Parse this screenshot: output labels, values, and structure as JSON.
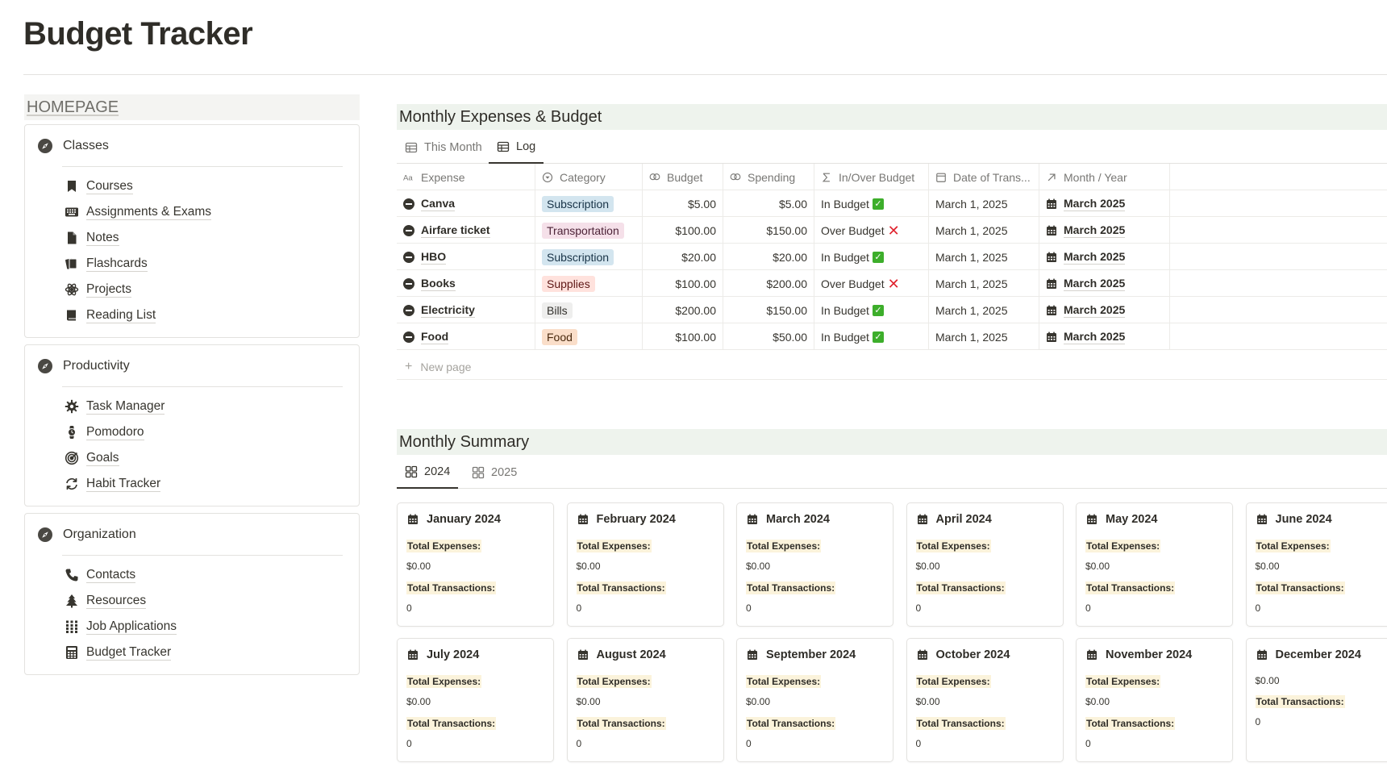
{
  "page": {
    "title": "Budget Tracker"
  },
  "sidebar": {
    "homepage_label": "HOMEPAGE",
    "groups": [
      {
        "title": "Classes",
        "icon": "compass-icon",
        "items": [
          {
            "label": "Courses",
            "icon": "bookmark-icon"
          },
          {
            "label": "Assignments & Exams",
            "icon": "keyboard-icon"
          },
          {
            "label": "Notes",
            "icon": "document-icon"
          },
          {
            "label": "Flashcards",
            "icon": "cards-icon"
          },
          {
            "label": "Projects",
            "icon": "atom-icon"
          },
          {
            "label": "Reading List",
            "icon": "book-icon"
          }
        ]
      },
      {
        "title": "Productivity",
        "icon": "compass-icon",
        "items": [
          {
            "label": "Task Manager",
            "icon": "gear-icon"
          },
          {
            "label": "Pomodoro",
            "icon": "watch-icon"
          },
          {
            "label": "Goals",
            "icon": "target-icon"
          },
          {
            "label": "Habit Tracker",
            "icon": "repeat-icon"
          }
        ]
      },
      {
        "title": "Organization",
        "icon": "compass-icon",
        "items": [
          {
            "label": "Contacts",
            "icon": "phone-icon"
          },
          {
            "label": "Resources",
            "icon": "tree-icon"
          },
          {
            "label": "Job Applications",
            "icon": "grid-icon"
          },
          {
            "label": "Budget Tracker",
            "icon": "calculator-icon"
          }
        ]
      }
    ]
  },
  "expenses": {
    "title": "Monthly Expenses & Budget",
    "tabs": [
      {
        "label": "This Month",
        "icon": "table-icon"
      },
      {
        "label": "Log",
        "icon": "table-icon"
      }
    ],
    "active_tab": "Log",
    "columns": [
      {
        "label": "Expense",
        "icon": "text-type-icon"
      },
      {
        "label": "Category",
        "icon": "select-icon"
      },
      {
        "label": "Budget",
        "icon": "formula-icon"
      },
      {
        "label": "Spending",
        "icon": "formula-icon"
      },
      {
        "label": "In/Over Budget",
        "icon": "sigma-icon"
      },
      {
        "label": "Date of Trans...",
        "icon": "calendar-icon"
      },
      {
        "label": "Month / Year",
        "icon": "relation-arrow-icon"
      }
    ],
    "rows": [
      {
        "expense": "Canva",
        "category": "Subscription",
        "budget": "$5.00",
        "spending": "$5.00",
        "status": "In Budget",
        "over": false,
        "date": "March 1, 2025",
        "month": "March 2025"
      },
      {
        "expense": "Airfare ticket",
        "category": "Transportation",
        "budget": "$100.00",
        "spending": "$150.00",
        "status": "Over Budget",
        "over": true,
        "date": "March 1, 2025",
        "month": "March 2025"
      },
      {
        "expense": "HBO",
        "category": "Subscription",
        "budget": "$20.00",
        "spending": "$20.00",
        "status": "In Budget",
        "over": false,
        "date": "March 1, 2025",
        "month": "March 2025"
      },
      {
        "expense": "Books",
        "category": "Supplies",
        "budget": "$100.00",
        "spending": "$200.00",
        "status": "Over Budget",
        "over": true,
        "date": "March 1, 2025",
        "month": "March 2025"
      },
      {
        "expense": "Electricity",
        "category": "Bills",
        "budget": "$200.00",
        "spending": "$150.00",
        "status": "In Budget",
        "over": false,
        "date": "March 1, 2025",
        "month": "March 2025"
      },
      {
        "expense": "Food",
        "category": "Food",
        "budget": "$100.00",
        "spending": "$50.00",
        "status": "In Budget",
        "over": false,
        "date": "March 1, 2025",
        "month": "March 2025"
      }
    ],
    "category_colors": {
      "Subscription": {
        "bg": "#d3e5ef",
        "fg": "#183347"
      },
      "Transportation": {
        "bg": "#f5e0e9",
        "fg": "#4c2337"
      },
      "Supplies": {
        "bg": "#ffe2dd",
        "fg": "#5d1715"
      },
      "Bills": {
        "bg": "#eeeeed",
        "fg": "#32302c"
      },
      "Food": {
        "bg": "#fadec9",
        "fg": "#49290e"
      }
    },
    "new_page_label": "New page"
  },
  "summary": {
    "title": "Monthly Summary",
    "tabs": [
      {
        "label": "2024",
        "icon": "gallery-icon"
      },
      {
        "label": "2025",
        "icon": "gallery-icon"
      }
    ],
    "active_tab": "2024",
    "expenses_label": "Total Expenses:",
    "transactions_label": "Total Transactions:",
    "months": [
      {
        "name": "January 2024",
        "expenses": "$0.00",
        "transactions": "0"
      },
      {
        "name": "February 2024",
        "expenses": "$0.00",
        "transactions": "0"
      },
      {
        "name": "March 2024",
        "expenses": "$0.00",
        "transactions": "0"
      },
      {
        "name": "April 2024",
        "expenses": "$0.00",
        "transactions": "0"
      },
      {
        "name": "May 2024",
        "expenses": "$0.00",
        "transactions": "0"
      },
      {
        "name": "June 2024",
        "expenses": "$0.00",
        "transactions": "0"
      },
      {
        "name": "July 2024",
        "expenses": "$0.00",
        "transactions": "0"
      },
      {
        "name": "August 2024",
        "expenses": "$0.00",
        "transactions": "0"
      },
      {
        "name": "September 2024",
        "expenses": "$0.00",
        "transactions": "0"
      },
      {
        "name": "October 2024",
        "expenses": "$0.00",
        "transactions": "0"
      },
      {
        "name": "November 2024",
        "expenses": "$0.00",
        "transactions": "0"
      },
      {
        "name": "December 2024",
        "expenses": "$0.00",
        "transactions": "0",
        "no_expenses_label": true
      }
    ]
  }
}
